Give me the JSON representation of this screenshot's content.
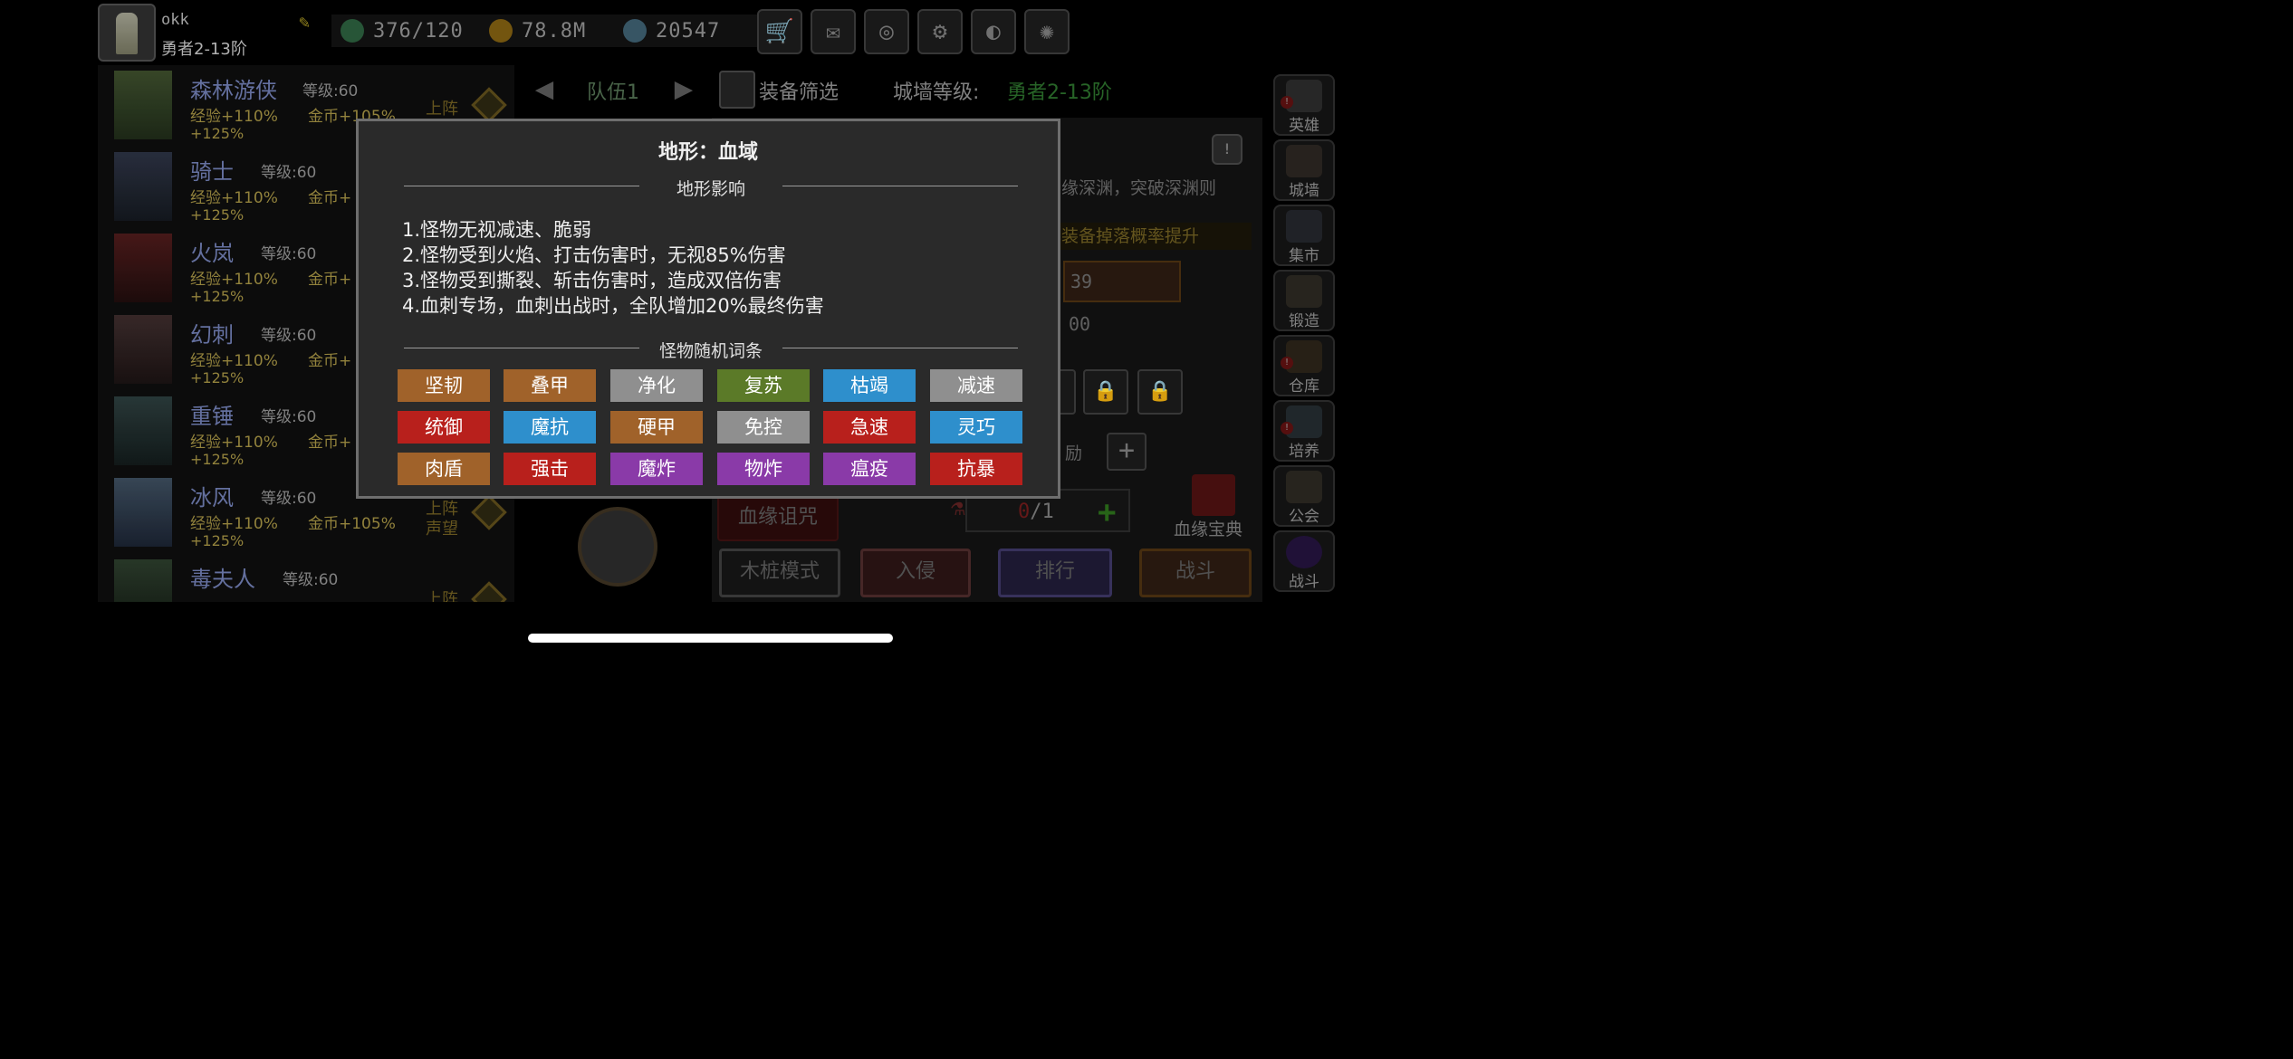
{
  "player": {
    "name": "okk",
    "rank": "勇者2-13阶"
  },
  "stats": {
    "energy": "376/120",
    "gold": "78.8M",
    "gems": "20547"
  },
  "top_buttons": [
    "cart-icon",
    "mail-icon",
    "gamepad-icon",
    "gear-icon",
    "colorwheel-icon",
    "firework-icon"
  ],
  "heroes": [
    {
      "name": "森林游侠",
      "level": "等级:60",
      "exp": "经验+110%",
      "gold": "金币+105%",
      "bonus": "+125%",
      "action": "上阵"
    },
    {
      "name": "骑士",
      "level": "等级:60",
      "exp": "经验+110%",
      "gold": "金币+",
      "bonus": "+125%",
      "action": ""
    },
    {
      "name": "火岚",
      "level": "等级:60",
      "exp": "经验+110%",
      "gold": "金币+",
      "bonus": "+125%",
      "action": ""
    },
    {
      "name": "幻刺",
      "level": "等级:60",
      "exp": "经验+110%",
      "gold": "金币+",
      "bonus": "+125%",
      "action": ""
    },
    {
      "name": "重锤",
      "level": "等级:60",
      "exp": "经验+110%",
      "gold": "金币+",
      "bonus": "+125%",
      "action": ""
    },
    {
      "name": "冰风",
      "level": "等级:60",
      "exp": "经验+110%",
      "gold": "金币+105%",
      "bonus": "+125%",
      "action": "上阵 声望"
    },
    {
      "name": "毒夫人",
      "level": "等级:60",
      "exp": "",
      "gold": "",
      "bonus": "",
      "action": "上阵"
    }
  ],
  "team": {
    "label": "队伍1",
    "filter": "装备筛选",
    "wall_label": "城墙等级:",
    "wall_value": "勇者2-13阶"
  },
  "panel": {
    "deep_text": "缘深渊，突破深渊则",
    "drop_text": "装备掉落概率提升",
    "value1": "39",
    "value2": "00",
    "reward_label": "励",
    "blood_curse": "血缘诅咒",
    "counter_current": "0",
    "counter_total": "/1",
    "book_label": "血缘宝典",
    "modes": [
      "木桩模式",
      "入侵",
      "排行",
      "战斗"
    ]
  },
  "sidebar": [
    {
      "label": "英雄",
      "badge": true
    },
    {
      "label": "城墙",
      "badge": false
    },
    {
      "label": "集市",
      "badge": false
    },
    {
      "label": "锻造",
      "badge": false
    },
    {
      "label": "仓库",
      "badge": true
    },
    {
      "label": "培养",
      "badge": true
    },
    {
      "label": "公会",
      "badge": false
    },
    {
      "label": "战斗",
      "badge": false
    }
  ],
  "dialog": {
    "title": "地形：血域",
    "effects_header": "地形影响",
    "effects": [
      "1.怪物无视减速、脆弱",
      "2.怪物受到火焰、打击伤害时，无视85%伤害",
      "3.怪物受到撕裂、斩击伤害时，造成双倍伤害",
      "4.血刺专场，血刺出战时，全队增加20%最终伤害"
    ],
    "traits_header": "怪物随机词条",
    "traits": [
      {
        "label": "坚韧",
        "color": "#a0622a"
      },
      {
        "label": "叠甲",
        "color": "#a0622a"
      },
      {
        "label": "净化",
        "color": "#8f8f8f"
      },
      {
        "label": "复苏",
        "color": "#5b7a28"
      },
      {
        "label": "枯竭",
        "color": "#2e8fcc"
      },
      {
        "label": "减速",
        "color": "#8f8f8f"
      },
      {
        "label": "统御",
        "color": "#b8201c"
      },
      {
        "label": "魔抗",
        "color": "#2e8fcc"
      },
      {
        "label": "硬甲",
        "color": "#a0622a"
      },
      {
        "label": "免控",
        "color": "#8f8f8f"
      },
      {
        "label": "急速",
        "color": "#b8201c"
      },
      {
        "label": "灵巧",
        "color": "#2e8fcc"
      },
      {
        "label": "肉盾",
        "color": "#a0622a"
      },
      {
        "label": "强击",
        "color": "#b8201c"
      },
      {
        "label": "魔炸",
        "color": "#8a3aa8"
      },
      {
        "label": "物炸",
        "color": "#8a3aa8"
      },
      {
        "label": "瘟疫",
        "color": "#8a3aa8"
      },
      {
        "label": "抗暴",
        "color": "#b8201c"
      }
    ]
  }
}
